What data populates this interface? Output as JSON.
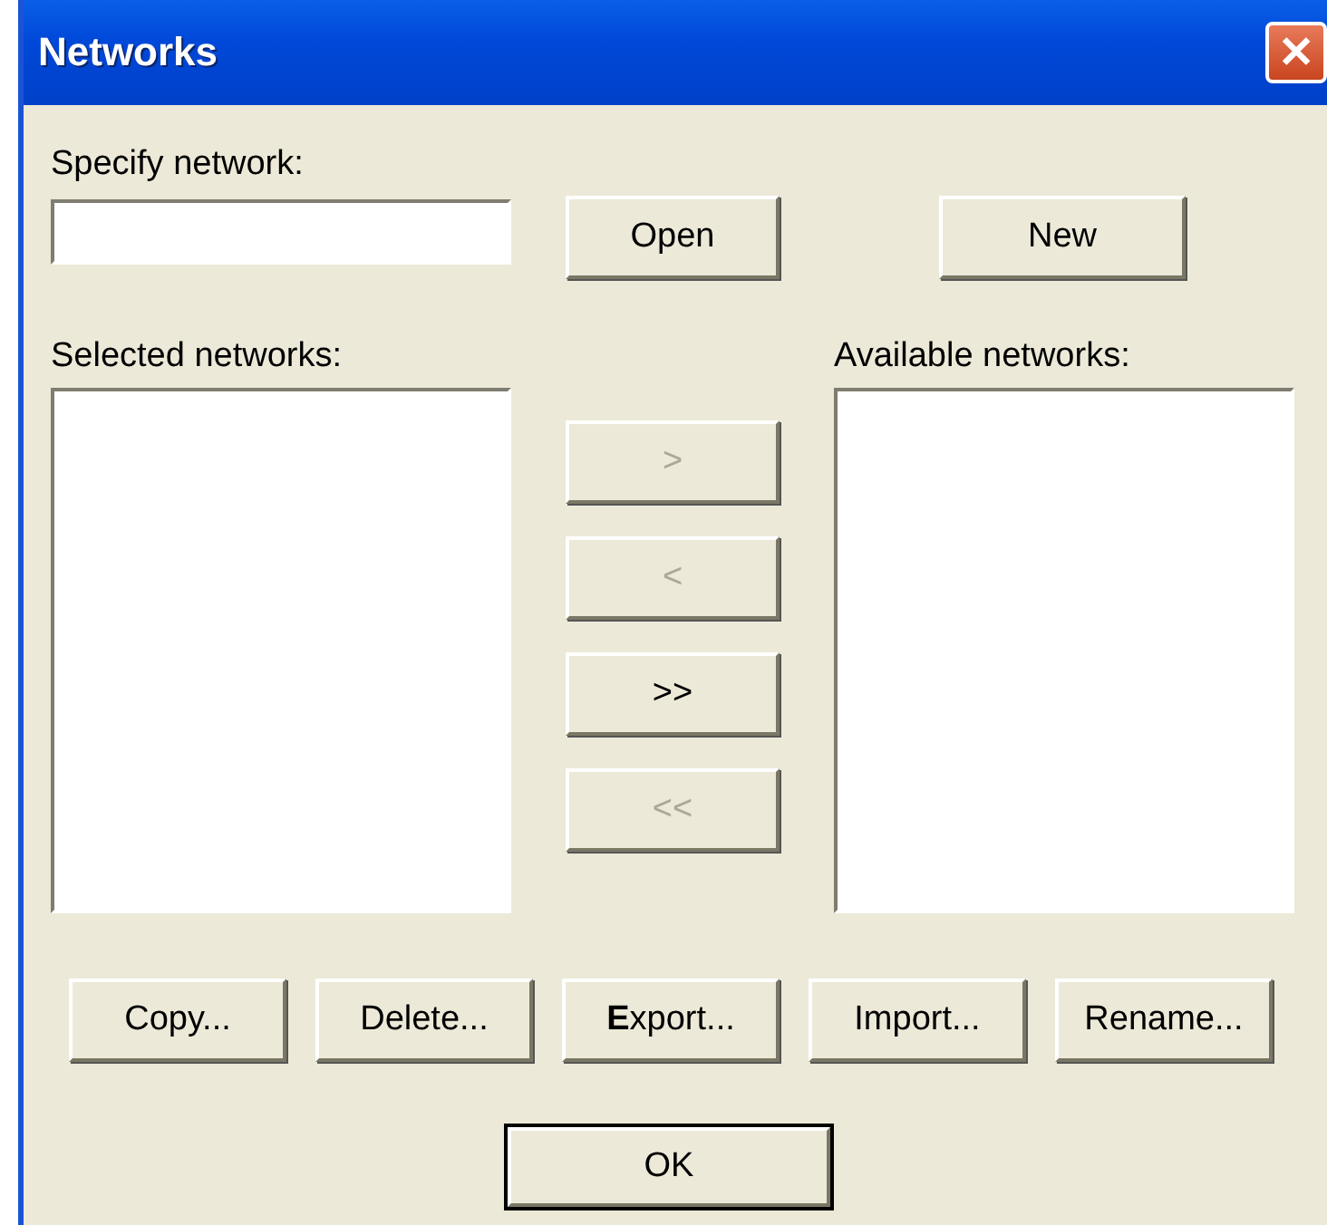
{
  "window": {
    "title": "Networks",
    "close_label": "✕"
  },
  "specify": {
    "label": "Specify network:"
  },
  "top_buttons": [
    {
      "label": "Open",
      "disabled": false
    },
    {
      "label": "New",
      "disabled": false
    }
  ],
  "selected_list": {
    "label": "Selected networks:"
  },
  "available_list": {
    "label": "Available networks:"
  },
  "move_buttons": [
    {
      "label": ">",
      "disabled": true
    },
    {
      "label": "<",
      "disabled": true
    },
    {
      "label": ">>",
      "disabled": false
    },
    {
      "label": "<<",
      "disabled": true
    }
  ],
  "action_buttons": [
    {
      "label": "Copy..."
    },
    {
      "label": "Delete..."
    },
    {
      "label": "**E**xport..."
    },
    {
      "label": "Import..."
    },
    {
      "label": "Rename..."
    }
  ],
  "ok_button": {
    "label": "OK",
    "default": true
  }
}
